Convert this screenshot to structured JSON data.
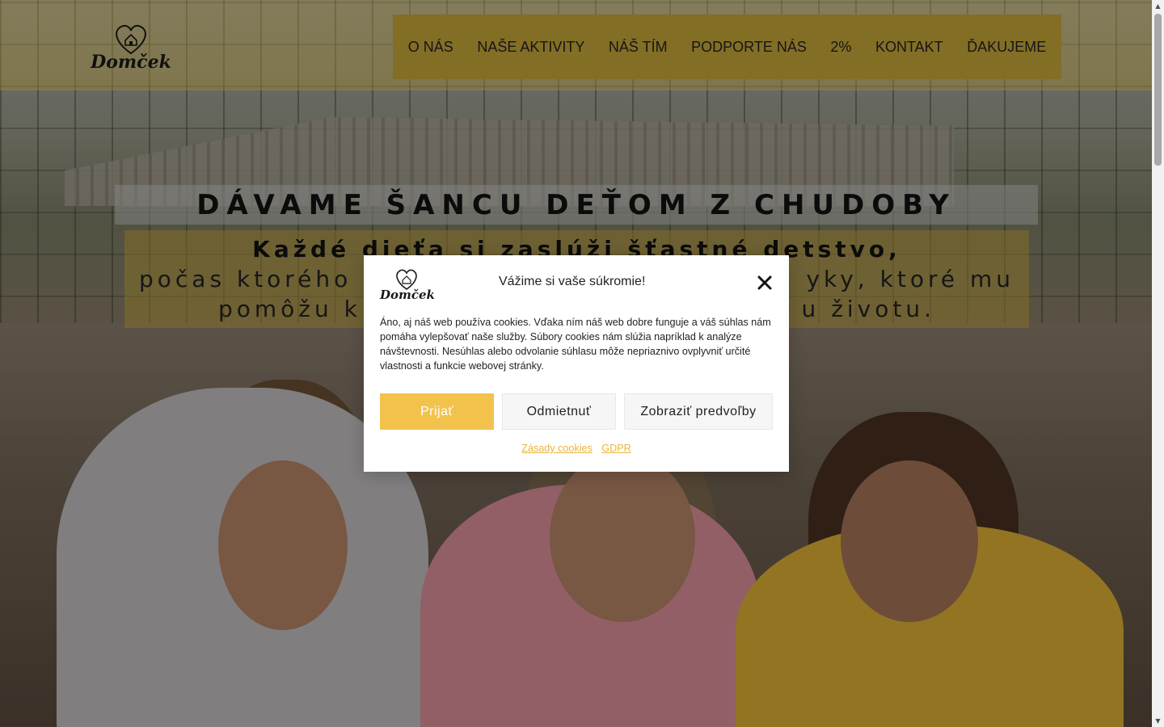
{
  "header": {
    "logo_text": "Domček",
    "nav": [
      {
        "label": "O NÁS"
      },
      {
        "label": "NAŠE AKTIVITY"
      },
      {
        "label": "NÁŠ TÍM"
      },
      {
        "label": "PODPORTE NÁS"
      },
      {
        "label": "2%"
      },
      {
        "label": "KONTAKT"
      },
      {
        "label": "ĎAKUJEME"
      }
    ]
  },
  "hero": {
    "headline": "DÁVAME ŠANCU DEŤOM Z CHUDOBY",
    "subtitle_line1": "Každé dieťa si zaslúži šťastné detstvo,",
    "subtitle_line2": "počas ktorého",
    "subtitle_line2_end": "yky, ktoré mu",
    "subtitle_line3": "pomôžu k",
    "subtitle_line3_end": "u životu."
  },
  "cookie_modal": {
    "logo_text": "Domček",
    "title": "Vážime si vaše súkromie!",
    "body": "Áno, aj náš web používa cookies. Vďaka ním náš web dobre funguje a váš súhlas nám pomáha vylepšovať naše služby. Súbory cookies nám slúžia napríklad k analýze návštevnosti. Nesúhlas alebo odvolanie súhlasu môže nepriaznivo ovplyvniť určité vlastnosti a funkcie webovej stránky.",
    "accept_label": "Prijať",
    "deny_label": "Odmietnuť",
    "prefs_label": "Zobraziť predvoľby",
    "links": [
      {
        "label": "Zásady cookies"
      },
      {
        "label": "GDPR"
      }
    ],
    "accent_color": "#f3c24d"
  }
}
